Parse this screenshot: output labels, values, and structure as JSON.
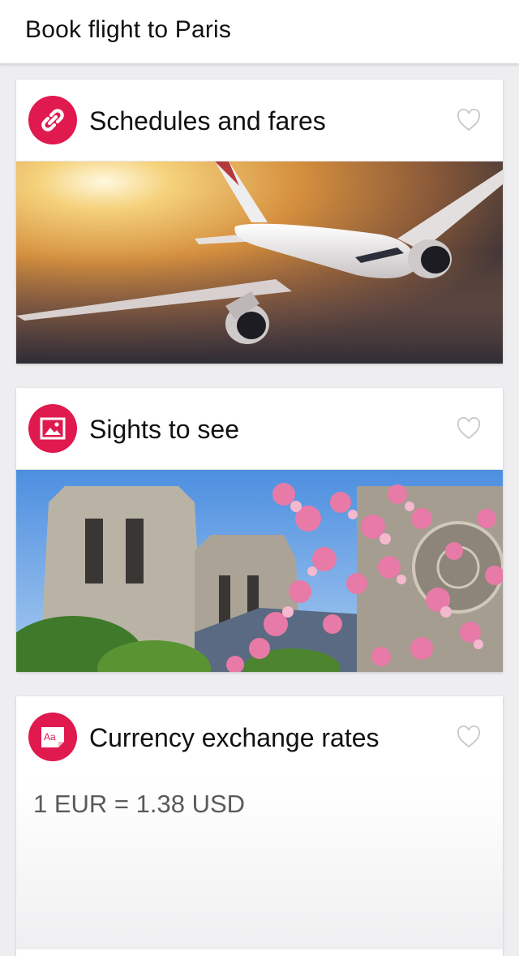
{
  "header": {
    "title": "Book flight to Paris"
  },
  "cards": [
    {
      "title": "Schedules and fares",
      "icon": "link-icon",
      "favorite_icon": "heart-outline-icon",
      "image": "airplane-photo"
    },
    {
      "title": "Sights to see",
      "icon": "image-icon",
      "favorite_icon": "heart-outline-icon",
      "image": "notre-dame-photo"
    },
    {
      "title": "Currency exchange rates",
      "icon": "dictionary-icon",
      "icon_text": "Aa",
      "favorite_icon": "heart-outline-icon",
      "rate": "1 EUR = 1.38 USD"
    }
  ],
  "colors": {
    "accent": "#e0194f",
    "background": "#eeeef0"
  }
}
